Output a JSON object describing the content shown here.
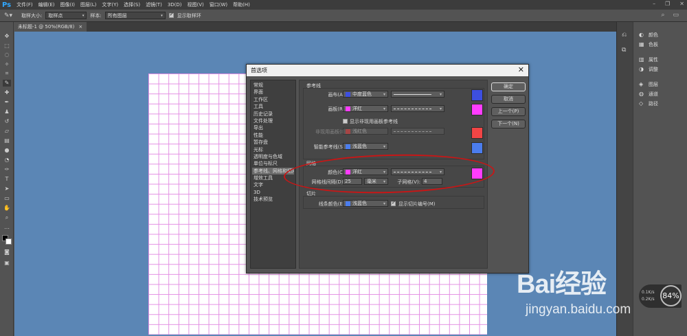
{
  "app": {
    "logo": "Ps"
  },
  "menubar": {
    "items": [
      "文件(F)",
      "编辑(E)",
      "图像(I)",
      "图层(L)",
      "文字(Y)",
      "选择(S)",
      "滤镜(T)",
      "3D(D)",
      "视图(V)",
      "窗口(W)",
      "帮助(H)"
    ]
  },
  "optionsbar": {
    "sample_size_label": "取样大小:",
    "sample_size_value": "取样点",
    "sample_label": "样本:",
    "sample_value": "所有图层",
    "show_ring_label": "显示取样环"
  },
  "document_tab": {
    "title": "未标题-1 @ 50%(RGB/8)",
    "close": "×"
  },
  "dialog": {
    "title": "首选项",
    "close": "✕",
    "categories": [
      "常规",
      "界面",
      "工作区",
      "工具",
      "历史记录",
      "文件处理",
      "导出",
      "性能",
      "暂存盘",
      "光标",
      "透明度与色域",
      "单位与标尺",
      "参考线、网格和切片",
      "增效工具",
      "文字",
      "3D",
      "技术预览"
    ],
    "selected_category_index": 12,
    "guides": {
      "section_title": "参考线",
      "canvas_label": "画布(A):",
      "canvas_color_name": "中度蓝色",
      "canvas_color": "#3d4fe0",
      "canvas_style": "solid",
      "artboard_label": "画板(R):",
      "artboard_color_name": "洋红",
      "artboard_color": "#ff3cff",
      "artboard_style": "dashed",
      "show_nonselected_label": "显示非现用画板参考线",
      "nonselected_label": "非现用画板(I):",
      "nonselected_color_name": "浅红色",
      "nonselected_color": "#f24545",
      "smart_label": "智能参考线(S):",
      "smart_color_name": "浅蓝色",
      "smart_color": "#4b7dee"
    },
    "grid": {
      "section_title": "网格",
      "color_label": "颜色(C):",
      "color_name": "洋红",
      "color": "#ff3cff",
      "spacing_label": "网格线间隔(D):",
      "spacing_value": "25",
      "unit_value": "毫米",
      "subdiv_label": "子网格(V):",
      "subdiv_value": "4"
    },
    "slices": {
      "section_title": "切片",
      "line_color_label": "线条颜色(E):",
      "line_color_name": "浅蓝色",
      "line_color": "#4b7dee",
      "show_numbers_label": "显示切片编号(M)"
    },
    "buttons": {
      "ok": "确定",
      "cancel": "取消",
      "prev": "上一个(P)",
      "next": "下一个(N)"
    }
  },
  "panels": {
    "items": [
      "颜色",
      "色板",
      "属性",
      "调整",
      "图层",
      "通道",
      "路径"
    ]
  },
  "watermark": {
    "brand": "Bai经验",
    "url": "jingyan.baidu.com"
  },
  "net_widget": {
    "percent": "84%",
    "up": "0.1K/s",
    "down": "0.2K/s"
  }
}
